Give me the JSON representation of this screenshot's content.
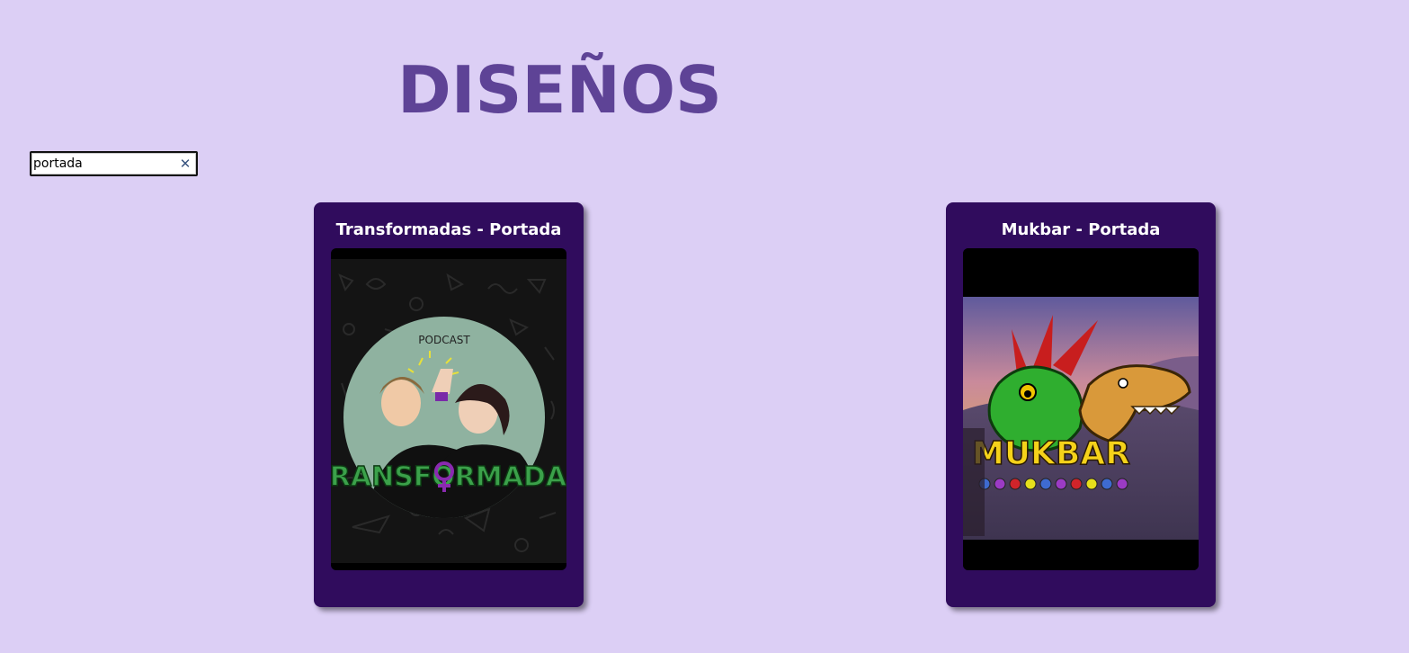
{
  "page": {
    "title": "DISEÑOS"
  },
  "search": {
    "value": "portada",
    "clear_icon": "close-icon"
  },
  "cards": [
    {
      "title": "Transformadas - Portada",
      "image": {
        "podcast_label": "PODCAST",
        "logo_text": "TRANSFORMADAS"
      }
    },
    {
      "title": "Mukbar - Portada",
      "image": {
        "logo_text": "MUKBAR"
      }
    }
  ],
  "colors": {
    "background": "#dccff5",
    "title": "#5e4396",
    "card": "#300c5d"
  }
}
